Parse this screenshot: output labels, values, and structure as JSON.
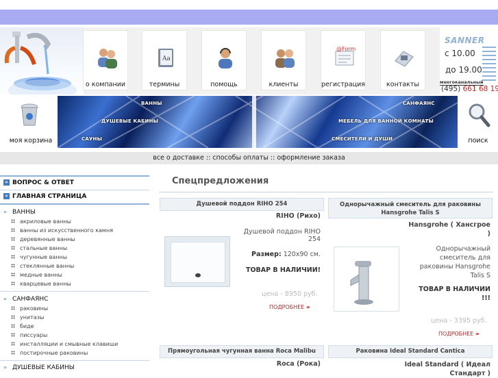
{
  "nav": {
    "items": [
      {
        "label": "о компании",
        "icon": "people-icon"
      },
      {
        "label": "термины",
        "icon": "book-icon"
      },
      {
        "label": "помощь",
        "icon": "support-icon"
      },
      {
        "label": "клиенты",
        "icon": "clients-icon"
      },
      {
        "label": "регистрация",
        "icon": "form-icon"
      },
      {
        "label": "контакты",
        "icon": "phone-icon"
      }
    ]
  },
  "brand": {
    "name": "SANNER",
    "hours_from": "с 10.00",
    "hours_to": "до 19.00",
    "multichannel": "многоканальный",
    "phone_code": "(495)",
    "phone_number": "661 68 19",
    "accent": "#cc2222"
  },
  "header": {
    "cart_label": "моя корзина",
    "search_label": "поиск",
    "banner_links": {
      "baths": "ВАННЫ",
      "showers": "ДУШЕВЫЕ КАБИНЫ",
      "saunas": "САУНЫ",
      "sanfayans": "САНФАЯНС",
      "furniture": "МЕБЕЛЬ ДЛЯ ВАННОЙ КОМНАТЫ",
      "mixers": "СМЕСИТЕЛИ И ДУШИ"
    }
  },
  "delivery_bar": "все о доставке :: способы оплаты :: оформление заказа",
  "sidebar": {
    "faq": "ВОПРОС & ОТВЕТ",
    "home": "ГЛАВНАЯ СТРАНИЦА",
    "baths": {
      "title": "ВАННЫ",
      "items": [
        "акриловые ванны",
        "ванны из искусственного камня",
        "деревянные ванны",
        "стальные ванны",
        "чугунные ванны",
        "стеклянные ванны",
        "медные ванны",
        "кварцевые ванны"
      ]
    },
    "sanfayans": {
      "title": "САНФАЯНС",
      "items": [
        "раковины",
        "унитазы",
        "биде",
        "писсуары",
        "инсталляции и смывные клавиши",
        "постирочные раковины"
      ]
    },
    "showers": {
      "title": "ДУШЕВЫЕ КАБИНЫ"
    }
  },
  "main": {
    "title": "Спецпредложения",
    "products": [
      {
        "title": "Душевой поддон RIHO 254",
        "brand": "RIHO (Рихо)",
        "desc": "Душевой поддон RIHO 254",
        "size_label": "Размер:",
        "size_value": "120x90 см.",
        "stock": "ТОВАР В НАЛИЧИИ!",
        "price": "цена - 8950 руб.",
        "more": "ПОДРОБНЕЕ"
      },
      {
        "title": "Однорычажный смеситель для раковины Hansgrohe Talis S",
        "brand": "Hansgrohe ( Хансгрое )",
        "desc": "Однорычажный смеситель для раковины Hansgrohe Talis S",
        "stock": "ТОВАР В НАЛИЧИИ !!!",
        "price": "цена - 3395 руб.",
        "more": "ПОДРОБНЕЕ"
      },
      {
        "title": "Прямоугольная чугунная ванна Roca Malibu",
        "brand": "Roca (Рока)"
      },
      {
        "title": "Раковина Ideal Standard Cantica",
        "brand": "Ideal Standard ( Идеал Стандарт )"
      }
    ]
  }
}
